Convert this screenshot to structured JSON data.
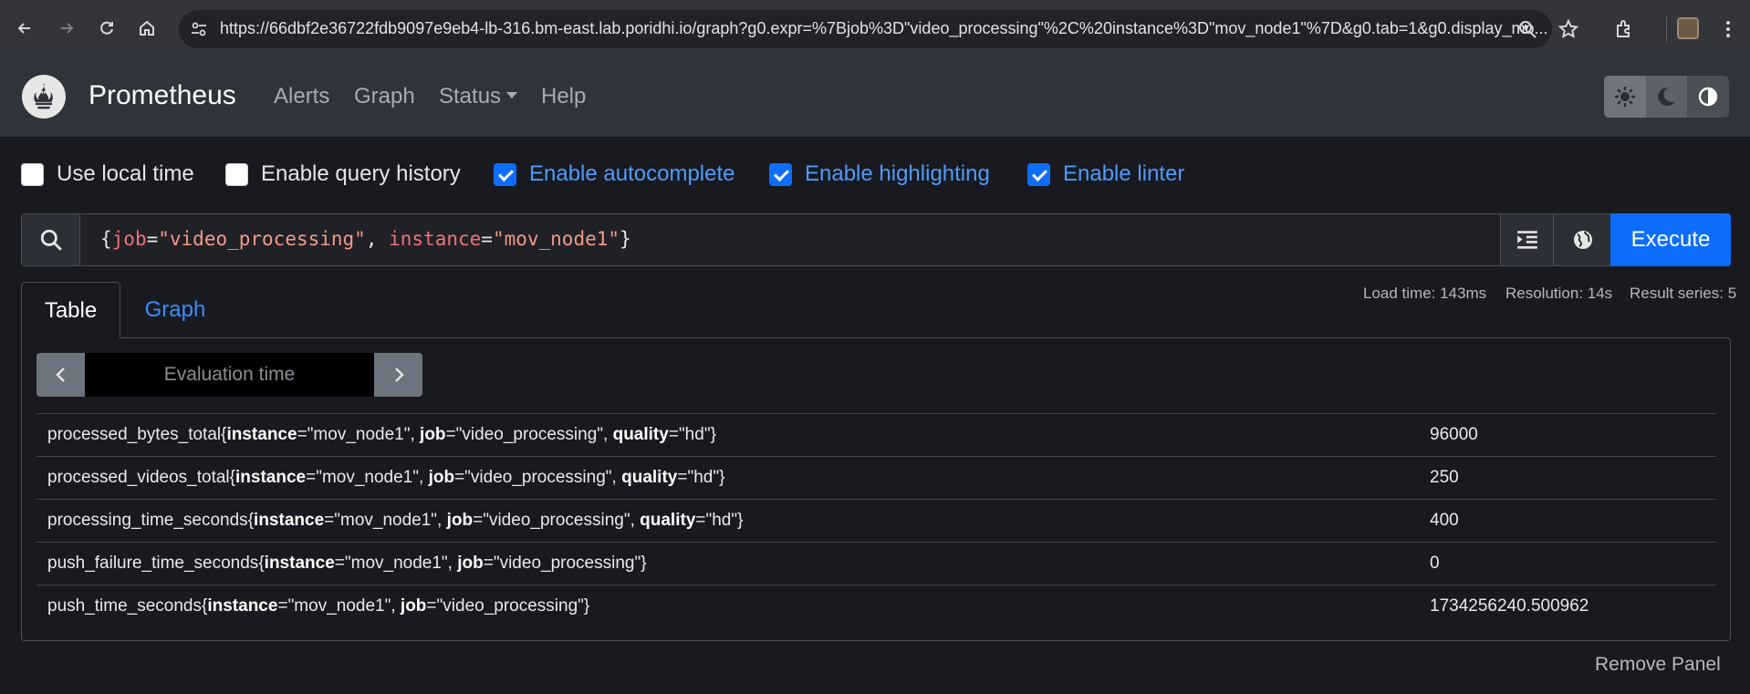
{
  "browser": {
    "url": "https://66dbf2e36722fdb9097e9eb4-lb-316.bm-east.lab.poridhi.io/graph?g0.expr=%7Bjob%3D\"video_processing\"%2C%20instance%3D\"mov_node1\"%7D&g0.tab=1&g0.display_mo..."
  },
  "navbar": {
    "brand": "Prometheus",
    "items": [
      "Alerts",
      "Graph",
      "Status",
      "Help"
    ]
  },
  "options": [
    {
      "label": "Use local time",
      "checked": false
    },
    {
      "label": "Enable query history",
      "checked": false
    },
    {
      "label": "Enable autocomplete",
      "checked": true
    },
    {
      "label": "Enable highlighting",
      "checked": true
    },
    {
      "label": "Enable linter",
      "checked": true
    }
  ],
  "query": {
    "open": "{",
    "label1": "job",
    "eq": "=",
    "value1": "\"video_processing\"",
    "sep": ", ",
    "label2": "instance",
    "value2": "\"mov_node1\"",
    "close": "}"
  },
  "execute_label": "Execute",
  "tabs": {
    "table": "Table",
    "graph": "Graph"
  },
  "stats": {
    "load_time": "Load time: 143ms",
    "resolution": "Resolution: 14s",
    "result_series": "Result series: 5"
  },
  "eval_placeholder": "Evaluation time",
  "results": [
    {
      "metric": "processed_bytes_total",
      "instance": "\"mov_node1\"",
      "job": "\"video_processing\"",
      "quality": "\"hd\"",
      "value": "96000"
    },
    {
      "metric": "processed_videos_total",
      "instance": "\"mov_node1\"",
      "job": "\"video_processing\"",
      "quality": "\"hd\"",
      "value": "250"
    },
    {
      "metric": "processing_time_seconds",
      "instance": "\"mov_node1\"",
      "job": "\"video_processing\"",
      "quality": "\"hd\"",
      "value": "400"
    },
    {
      "metric": "push_failure_time_seconds",
      "instance": "\"mov_node1\"",
      "job": "\"video_processing\"",
      "quality": null,
      "value": "0"
    },
    {
      "metric": "push_time_seconds",
      "instance": "\"mov_node1\"",
      "job": "\"video_processing\"",
      "quality": null,
      "value": "1734256240.500962"
    }
  ],
  "remove_panel": "Remove Panel",
  "colors": {
    "accent": "#0d6efd",
    "link": "#3d8bfd",
    "navbar": "#30343a",
    "background": "#181a1f"
  }
}
